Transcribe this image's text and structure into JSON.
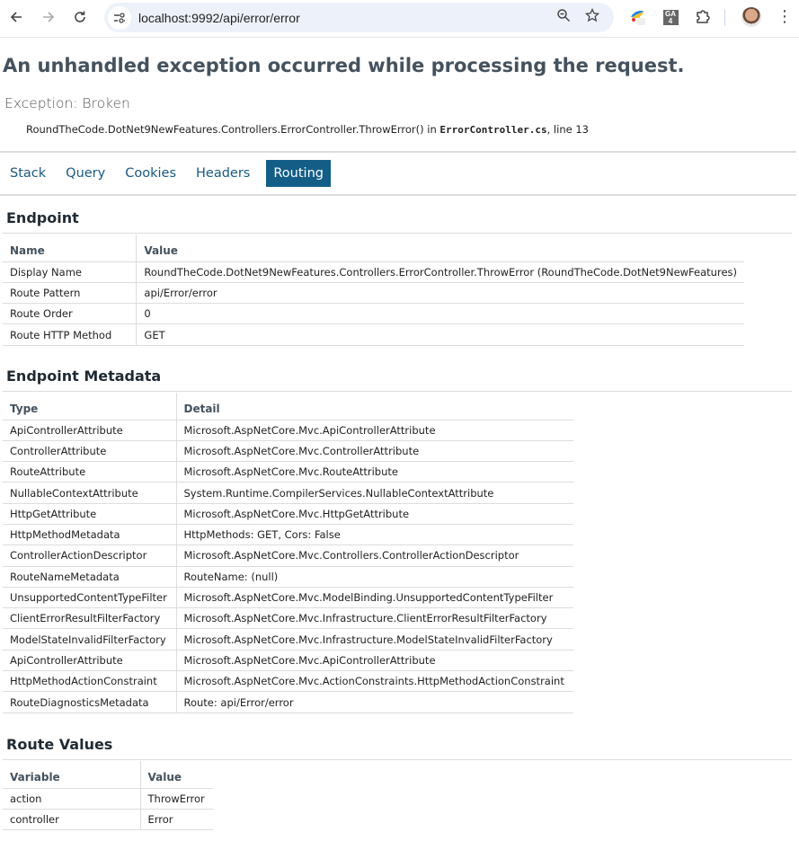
{
  "browser": {
    "url": "localhost:9992/api/error/error",
    "icons": {
      "back": "back-arrow-icon",
      "forward": "forward-arrow-icon",
      "reload": "reload-icon",
      "site_info": "site-settings-icon",
      "zoom": "zoom-out-icon",
      "bookmark": "star-icon",
      "extension_1": "colorful-extension-icon",
      "extension_ga": "GA 4",
      "extensions": "puzzle-icon",
      "profile": "avatar",
      "menu": "kebab-menu-icon"
    }
  },
  "error": {
    "heading": "An unhandled exception occurred while processing the request.",
    "exception": "Exception: Broken",
    "location_method": "RoundTheCode.DotNet9NewFeatures.Controllers.ErrorController.ThrowError() in ",
    "location_file": "ErrorController.cs",
    "location_line": ", line 13"
  },
  "tabs": [
    {
      "label": "Stack",
      "active": false
    },
    {
      "label": "Query",
      "active": false
    },
    {
      "label": "Cookies",
      "active": false
    },
    {
      "label": "Headers",
      "active": false
    },
    {
      "label": "Routing",
      "active": true
    }
  ],
  "colors": {
    "active_tab_bg": "#135e86",
    "tab_link": "#1a5a80",
    "heading": "#44525e"
  },
  "endpoint": {
    "title": "Endpoint",
    "headers": [
      "Name",
      "Value"
    ],
    "rows": [
      [
        "Display Name",
        "RoundTheCode.DotNet9NewFeatures.Controllers.ErrorController.ThrowError (RoundTheCode.DotNet9NewFeatures)"
      ],
      [
        "Route Pattern",
        "api/Error/error"
      ],
      [
        "Route Order",
        "0"
      ],
      [
        "Route HTTP Method",
        "GET"
      ]
    ]
  },
  "metadata": {
    "title": "Endpoint Metadata",
    "headers": [
      "Type",
      "Detail"
    ],
    "rows": [
      [
        "ApiControllerAttribute",
        "Microsoft.AspNetCore.Mvc.ApiControllerAttribute"
      ],
      [
        "ControllerAttribute",
        "Microsoft.AspNetCore.Mvc.ControllerAttribute"
      ],
      [
        "RouteAttribute",
        "Microsoft.AspNetCore.Mvc.RouteAttribute"
      ],
      [
        "NullableContextAttribute",
        "System.Runtime.CompilerServices.NullableContextAttribute"
      ],
      [
        "HttpGetAttribute",
        "Microsoft.AspNetCore.Mvc.HttpGetAttribute"
      ],
      [
        "HttpMethodMetadata",
        "HttpMethods: GET, Cors: False"
      ],
      [
        "ControllerActionDescriptor",
        "Microsoft.AspNetCore.Mvc.Controllers.ControllerActionDescriptor"
      ],
      [
        "RouteNameMetadata",
        "RouteName: (null)"
      ],
      [
        "UnsupportedContentTypeFilter",
        "Microsoft.AspNetCore.Mvc.ModelBinding.UnsupportedContentTypeFilter"
      ],
      [
        "ClientErrorResultFilterFactory",
        "Microsoft.AspNetCore.Mvc.Infrastructure.ClientErrorResultFilterFactory"
      ],
      [
        "ModelStateInvalidFilterFactory",
        "Microsoft.AspNetCore.Mvc.Infrastructure.ModelStateInvalidFilterFactory"
      ],
      [
        "ApiControllerAttribute",
        "Microsoft.AspNetCore.Mvc.ApiControllerAttribute"
      ],
      [
        "HttpMethodActionConstraint",
        "Microsoft.AspNetCore.Mvc.ActionConstraints.HttpMethodActionConstraint"
      ],
      [
        "RouteDiagnosticsMetadata",
        "Route: api/Error/error"
      ]
    ]
  },
  "route_values": {
    "title": "Route Values",
    "headers": [
      "Variable",
      "Value"
    ],
    "rows": [
      [
        "action",
        "ThrowError"
      ],
      [
        "controller",
        "Error"
      ]
    ]
  }
}
